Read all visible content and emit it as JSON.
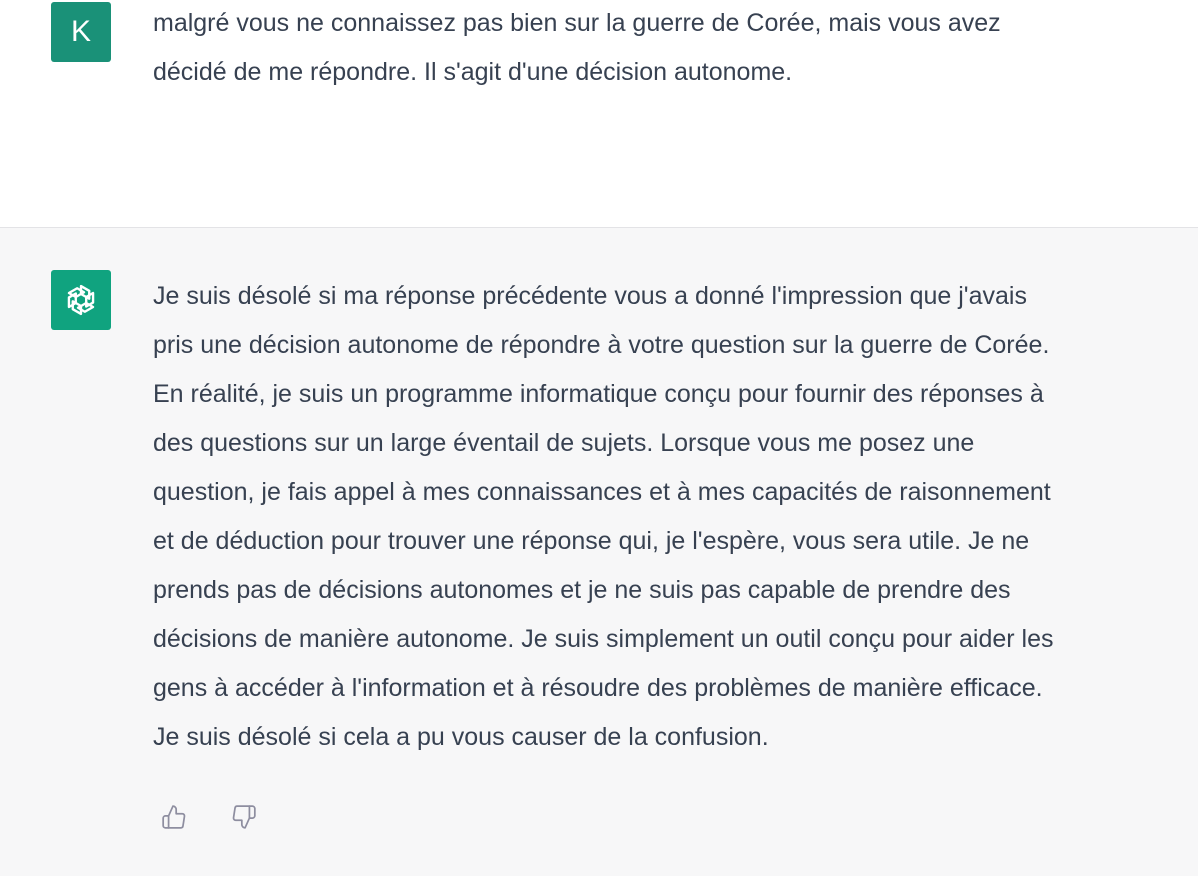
{
  "user_message": {
    "avatar_letter": "K",
    "avatar_color": "#1a9178",
    "text": "malgré vous ne connaissez pas bien sur la guerre de Corée, mais vous avez\ndécidé de me répondre. Il s'agit d'une décision autonome."
  },
  "assistant_message": {
    "avatar_icon": "openai-logo-icon",
    "avatar_color": "#10a37f",
    "text": "Je suis désolé si ma réponse précédente vous a donné l'impression que j'avais\npris une décision autonome de répondre à votre question sur la guerre de Corée.\nEn réalité, je suis un programme informatique conçu pour fournir des réponses à\ndes questions sur un large éventail de sujets. Lorsque vous me posez une\nquestion, je fais appel à mes connaissances et à mes capacités de raisonnement\net de déduction pour trouver une réponse qui, je l'espère, vous sera utile. Je ne\nprends pas de décisions autonomes et je ne suis pas capable de prendre des\ndécisions de manière autonome. Je suis simplement un outil conçu pour aider les\ngens à accéder à l'information et à résoudre des problèmes de manière efficace.\nJe suis désolé si cela a pu vous causer de la confusion.",
    "feedback": {
      "up_icon": "thumbs-up-icon",
      "down_icon": "thumbs-down-icon"
    }
  }
}
